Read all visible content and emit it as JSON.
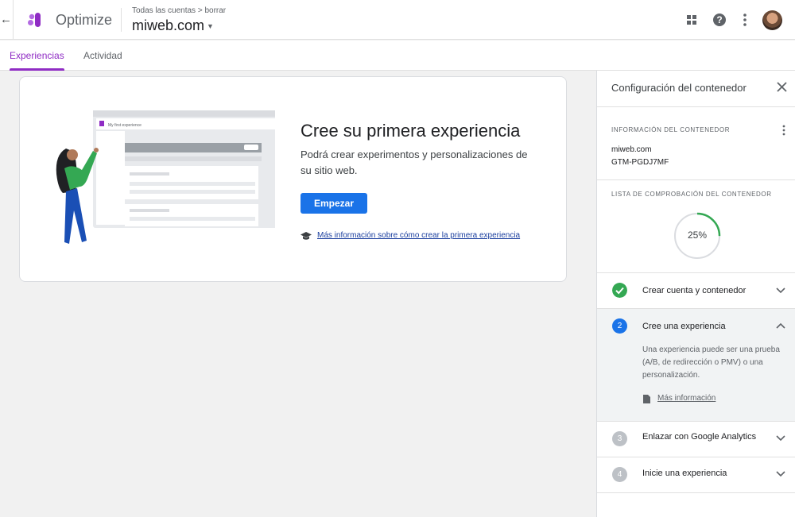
{
  "header": {
    "app_name": "Optimize",
    "breadcrumb": "Todas las cuentas > borrar",
    "site": "miweb.com",
    "icons": [
      "back-arrow-icon",
      "optimize-logo",
      "apps-grid-icon",
      "help-icon",
      "more-vert-icon",
      "avatar"
    ],
    "help_glyph": "?"
  },
  "tabs": [
    {
      "label": "Experiencias",
      "active": true
    },
    {
      "label": "Actividad",
      "active": false
    }
  ],
  "card": {
    "title": "Cree su primera experiencia",
    "description": "Podrá crear experimentos y personalizaciones de su sitio web.",
    "start_button": "Empezar",
    "learn_link": "Más información sobre cómo crear la primera experiencia",
    "illustration_label": "My first experience"
  },
  "panel": {
    "title": "Configuración del contenedor",
    "info_heading": "INFORMACIÓN DEL CONTENEDOR",
    "container_domain": "miweb.com",
    "container_id": "GTM-PGDJ7MF",
    "checklist_heading": "LISTA DE COMPROBACIÓN DEL CONTENEDOR",
    "progress_label": "25%",
    "progress_value": 0.25,
    "steps": [
      {
        "number": "1",
        "label": "Crear cuenta y contenedor",
        "status": "complete",
        "expanded": false
      },
      {
        "number": "2",
        "label": "Cree una experiencia",
        "status": "current",
        "expanded": true,
        "description": "Una experiencia puede ser una prueba (A/B, de redirección o PMV) o una personalización.",
        "link": "Más información"
      },
      {
        "number": "3",
        "label": "Enlazar con Google Analytics",
        "status": "pending",
        "expanded": false
      },
      {
        "number": "4",
        "label": "Inicie una experiencia",
        "status": "pending",
        "expanded": false
      }
    ]
  },
  "colors": {
    "accent_purple": "#8f2cc4",
    "primary_blue": "#1a73e8",
    "success_green": "#34a853",
    "pending_gray": "#bdc1c6"
  }
}
